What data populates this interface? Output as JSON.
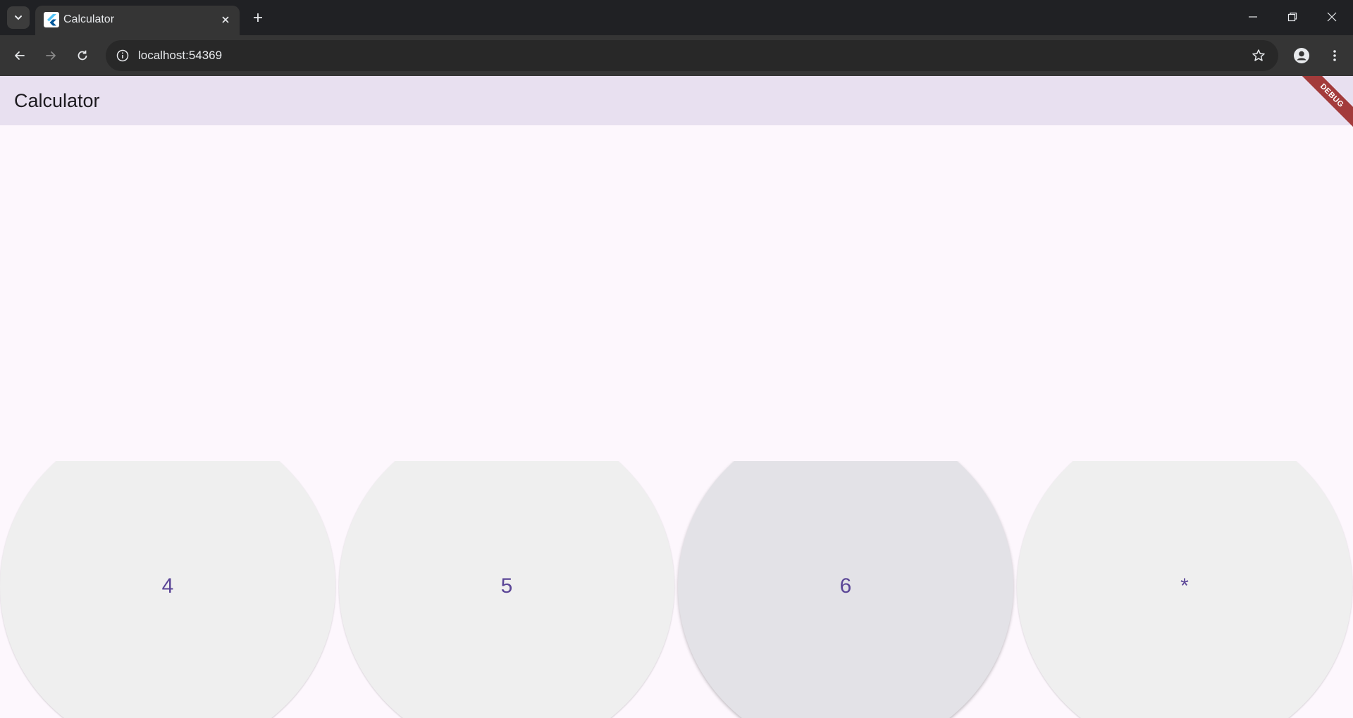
{
  "browser": {
    "tab_title": "Calculator",
    "url": "localhost:54369"
  },
  "app": {
    "title": "Calculator",
    "debug_label": "DEBUG",
    "display_value": "",
    "colors": {
      "appbar": "#e8e0f0",
      "background": "#fdf7fd",
      "key": "#efefef",
      "key_hover": "#e3e2e7",
      "key_text": "#5b4697",
      "debug_ribbon": "#a33b3b"
    }
  },
  "keys": [
    {
      "label": "4"
    },
    {
      "label": "5"
    },
    {
      "label": "6",
      "state": "hover"
    },
    {
      "label": "*"
    }
  ]
}
